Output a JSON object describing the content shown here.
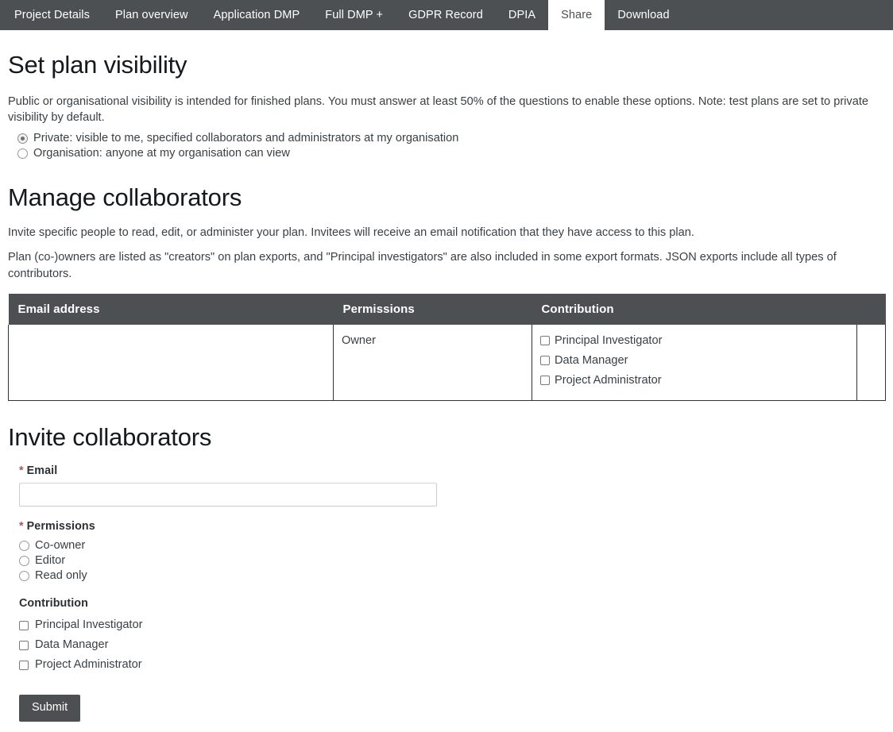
{
  "nav": {
    "tabs": [
      {
        "label": "Project Details",
        "active": false
      },
      {
        "label": "Plan overview",
        "active": false
      },
      {
        "label": "Application DMP",
        "active": false
      },
      {
        "label": "Full DMP +",
        "active": false
      },
      {
        "label": "GDPR Record",
        "active": false
      },
      {
        "label": "DPIA",
        "active": false
      },
      {
        "label": "Share",
        "active": true
      },
      {
        "label": "Download",
        "active": false
      }
    ]
  },
  "visibility": {
    "title": "Set plan visibility",
    "description": "Public or organisational visibility is intended for finished plans. You must answer at least 50% of the questions to enable these options. Note: test plans are set to private visibility by default.",
    "options": [
      {
        "label": "Private: visible to me, specified collaborators and administrators at my organisation",
        "selected": true
      },
      {
        "label": "Organisation: anyone at my organisation can view",
        "selected": false
      }
    ]
  },
  "manage": {
    "title": "Manage collaborators",
    "paragraph1": "Invite specific people to read, edit, or administer your plan. Invitees will receive an email notification that they have access to this plan.",
    "paragraph2": "Plan (co-)owners are listed as \"creators\" on plan exports, and \"Principal investigators\" are also included in some export formats. JSON exports include all types of contributors.",
    "table": {
      "headers": {
        "email": "Email address",
        "permissions": "Permissions",
        "contribution": "Contribution",
        "actions": ""
      },
      "rows": [
        {
          "email": "",
          "permissions": "Owner",
          "contributions": [
            {
              "label": "Principal Investigator",
              "checked": false
            },
            {
              "label": "Data Manager",
              "checked": false
            },
            {
              "label": "Project Administrator",
              "checked": false
            }
          ]
        }
      ]
    }
  },
  "invite": {
    "title": "Invite collaborators",
    "required_marker": "*",
    "email": {
      "label": "Email",
      "value": "",
      "placeholder": ""
    },
    "permissions": {
      "label": "Permissions",
      "options": [
        {
          "label": "Co-owner",
          "selected": false
        },
        {
          "label": "Editor",
          "selected": false
        },
        {
          "label": "Read only",
          "selected": false
        }
      ]
    },
    "contribution": {
      "label": "Contribution",
      "options": [
        {
          "label": "Principal Investigator",
          "checked": false
        },
        {
          "label": "Data Manager",
          "checked": false
        },
        {
          "label": "Project Administrator",
          "checked": false
        }
      ]
    },
    "submit_label": "Submit"
  },
  "colors": {
    "nav_background": "#4d5052",
    "table_header_background": "#4d5052",
    "required_asterisk": "#b5544c",
    "body_text": "#3a3f44",
    "heading_text": "#15191c"
  }
}
